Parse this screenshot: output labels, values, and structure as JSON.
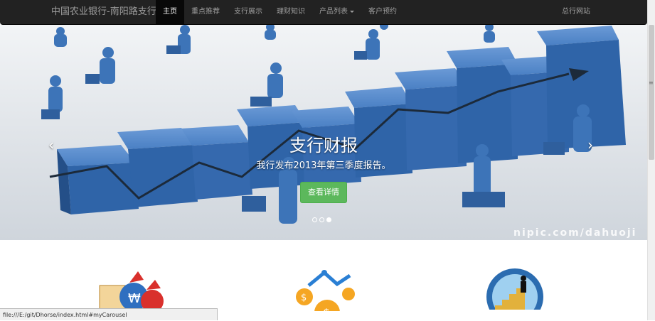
{
  "navbar": {
    "brand": "中国农业银行-南阳路支行",
    "items": [
      {
        "label": "主页",
        "active": true
      },
      {
        "label": "重点推荐"
      },
      {
        "label": "支行展示"
      },
      {
        "label": "理财知识"
      },
      {
        "label": "产品列表",
        "dropdown": true
      },
      {
        "label": "客户预约"
      }
    ],
    "right_link": "总行网站"
  },
  "carousel": {
    "title": "支行财报",
    "text": "我行发布2013年第三季度报告。",
    "button": "查看详情",
    "prev_icon": "chevron-left-icon",
    "next_icon": "chevron-right-icon",
    "indicators": 3,
    "active_indicator": 2,
    "watermark": "nipic.com/dahuoji"
  },
  "status_bar": {
    "url": "file:///E:/git/Dhorse/index.html#myCarousel"
  },
  "colors": {
    "navbar_bg": "#222222",
    "accent_green": "#5cb85c",
    "bar_blue": "#3d74b8"
  }
}
